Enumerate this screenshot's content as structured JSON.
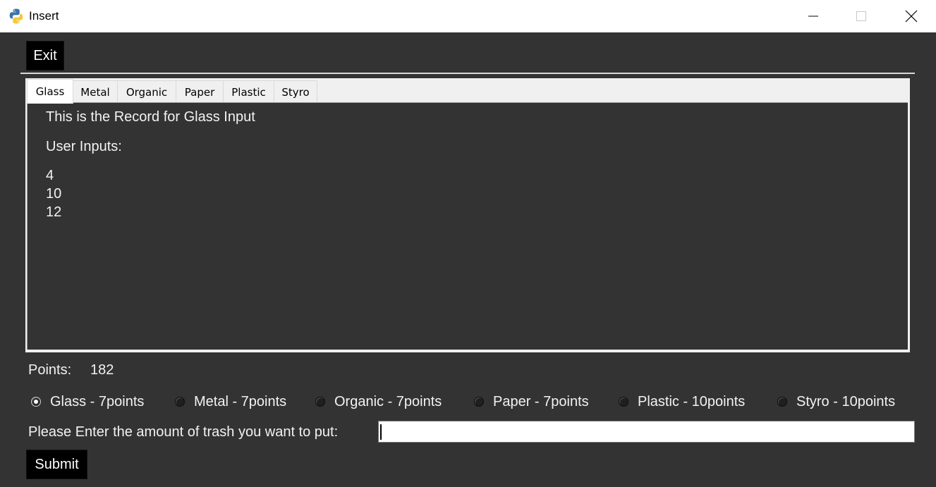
{
  "window": {
    "title": "Insert",
    "icon": "python-icon"
  },
  "toolbar": {
    "exit_label": "Exit"
  },
  "tabs": [
    {
      "label": "Glass",
      "active": true
    },
    {
      "label": "Metal",
      "active": false
    },
    {
      "label": "Organic",
      "active": false
    },
    {
      "label": "Paper",
      "active": false
    },
    {
      "label": "Plastic",
      "active": false
    },
    {
      "label": "Styro",
      "active": false
    }
  ],
  "panel": {
    "heading": "This is the Record for Glass Input",
    "inputs_label": "User Inputs:",
    "inputs": [
      "4",
      "10",
      "12"
    ]
  },
  "points": {
    "label": "Points:",
    "value": "182"
  },
  "radios": [
    {
      "label": "Glass - 7points",
      "checked": true
    },
    {
      "label": "Metal - 7points",
      "checked": false
    },
    {
      "label": "Organic - 7points",
      "checked": false
    },
    {
      "label": "Paper - 7points",
      "checked": false
    },
    {
      "label": "Plastic - 10points",
      "checked": false
    },
    {
      "label": "Styro - 10points",
      "checked": false
    }
  ],
  "form": {
    "prompt": "Please Enter the amount of trash you want to put:",
    "value": "",
    "submit_label": "Submit"
  },
  "colors": {
    "background": "#333333",
    "text": "#f2f2f2",
    "button": "#000000"
  }
}
